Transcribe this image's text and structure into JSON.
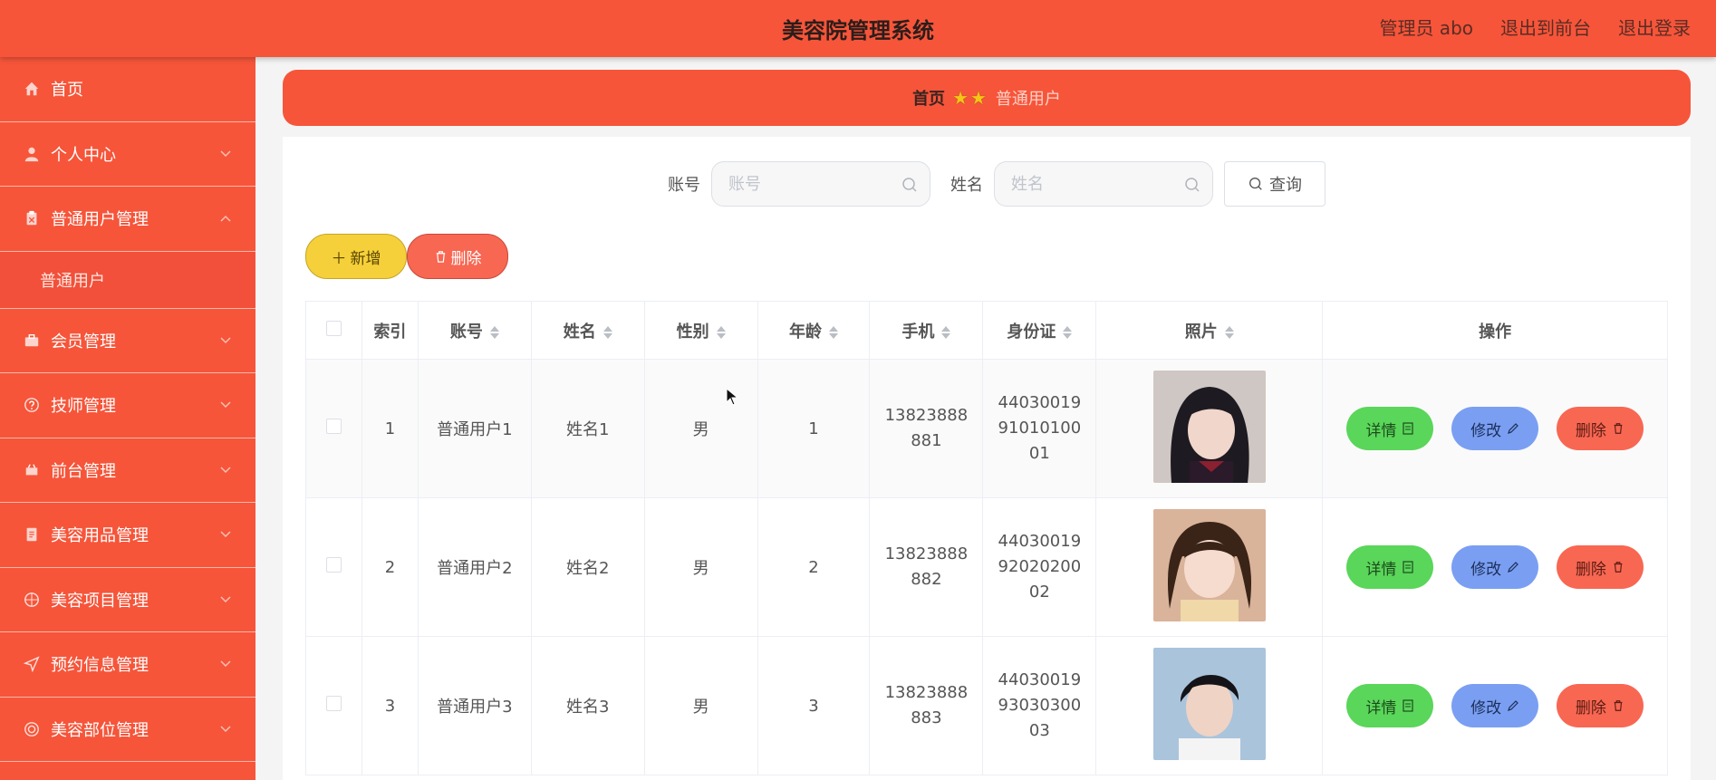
{
  "header": {
    "title": "美容院管理系统",
    "admin_label": "管理员 abo",
    "to_front_label": "退出到前台",
    "logout_label": "退出登录"
  },
  "sidebar": {
    "items": [
      {
        "label": "首页",
        "icon": "home-icon"
      },
      {
        "label": "个人中心",
        "icon": "user-icon"
      },
      {
        "label": "普通用户管理",
        "icon": "clipboard-icon",
        "expanded": true
      },
      {
        "label": "会员管理",
        "icon": "briefcase-icon"
      },
      {
        "label": "技师管理",
        "icon": "help-circle-icon"
      },
      {
        "label": "前台管理",
        "icon": "cart-icon"
      },
      {
        "label": "美容用品管理",
        "icon": "document-icon"
      },
      {
        "label": "美容项目管理",
        "icon": "globe-icon"
      },
      {
        "label": "预约信息管理",
        "icon": "send-icon"
      },
      {
        "label": "美容部位管理",
        "icon": "target-icon"
      }
    ],
    "submenu": {
      "label": "普通用户"
    }
  },
  "breadcrumb": {
    "home": "首页",
    "current": "普通用户"
  },
  "search": {
    "account_label": "账号",
    "account_placeholder": "账号",
    "name_label": "姓名",
    "name_placeholder": "姓名",
    "query_label": "查询"
  },
  "toolbar": {
    "add_label": "新增",
    "delete_label": "删除"
  },
  "table": {
    "headers": [
      "索引",
      "账号",
      "姓名",
      "性别",
      "年龄",
      "手机",
      "身份证",
      "照片",
      "操作"
    ],
    "rows": [
      {
        "index": "1",
        "account": "普通用户1",
        "name": "姓名1",
        "gender": "男",
        "age": "1",
        "phone": "13823888881",
        "id_card": "440300199101010001"
      },
      {
        "index": "2",
        "account": "普通用户2",
        "name": "姓名2",
        "gender": "男",
        "age": "2",
        "phone": "13823888882",
        "id_card": "440300199202020002"
      },
      {
        "index": "3",
        "account": "普通用户3",
        "name": "姓名3",
        "gender": "男",
        "age": "3",
        "phone": "13823888883",
        "id_card": "440300199303030003"
      }
    ],
    "actions": {
      "detail": "详情",
      "edit": "修改",
      "delete": "删除"
    }
  },
  "colors": {
    "primary": "#f6553a",
    "add_button": "#f5d03a",
    "detail_button": "#5ad65a",
    "edit_button": "#7a9ff2",
    "delete_button": "#f86752"
  }
}
